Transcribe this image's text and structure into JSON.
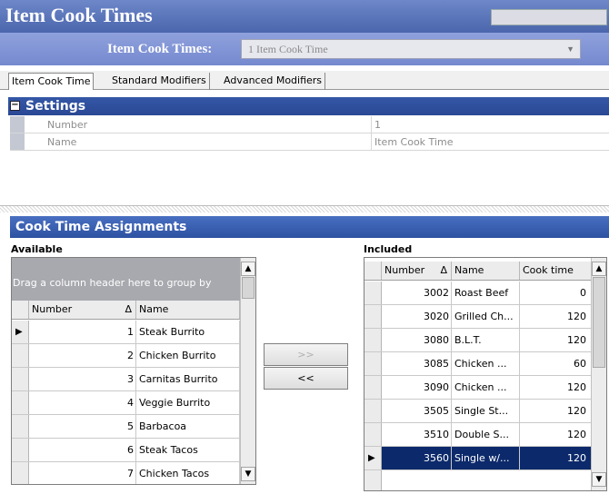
{
  "window": {
    "title": "Item Cook Times"
  },
  "selector": {
    "label": "Item Cook Times:",
    "value": "1 Item Cook Time"
  },
  "tabs": [
    {
      "label": "Item Cook Time"
    },
    {
      "label": "Standard Modifiers"
    },
    {
      "label": "Advanced Modifiers"
    }
  ],
  "settings": {
    "title": "Settings",
    "collapse_symbol": "−",
    "rows": [
      {
        "name": "Number",
        "value": "1"
      },
      {
        "name": "Name",
        "value": "Item Cook Time"
      }
    ]
  },
  "assignments": {
    "title": "Cook Time Assignments",
    "available": {
      "label": "Available",
      "group_hint": "Drag a column header here to group by",
      "col_number": "Number",
      "col_name": "Name",
      "sort_glyph": "Δ",
      "rows": [
        {
          "number": "1",
          "name": "Steak Burrito"
        },
        {
          "number": "2",
          "name": "Chicken Burrito"
        },
        {
          "number": "3",
          "name": "Carnitas Burrito"
        },
        {
          "number": "4",
          "name": "Veggie Burrito"
        },
        {
          "number": "5",
          "name": "Barbacoa"
        },
        {
          "number": "6",
          "name": "Steak Tacos"
        },
        {
          "number": "7",
          "name": "Chicken Tacos"
        }
      ]
    },
    "buttons": {
      "add": ">>",
      "remove": "<<"
    },
    "included": {
      "label": "Included",
      "col_number": "Number",
      "col_name": "Name",
      "col_cook": "Cook time",
      "sort_glyph": "Δ",
      "rows": [
        {
          "number": "3002",
          "name": "Roast Beef",
          "cook": "0"
        },
        {
          "number": "3020",
          "name": "Grilled Ch...",
          "cook": "120"
        },
        {
          "number": "3080",
          "name": "B.L.T.",
          "cook": "120"
        },
        {
          "number": "3085",
          "name": "Chicken ...",
          "cook": "60"
        },
        {
          "number": "3090",
          "name": "Chicken ...",
          "cook": "120"
        },
        {
          "number": "3505",
          "name": "Single St...",
          "cook": "120"
        },
        {
          "number": "3510",
          "name": "Double S...",
          "cook": "120"
        },
        {
          "number": "3560",
          "name": "Single w/...",
          "cook": "120",
          "selected": true
        }
      ]
    }
  },
  "colors": {
    "title_bar": "#4c66ad",
    "section_header": "#2a4894",
    "selected_row": "#0c2a6b"
  }
}
